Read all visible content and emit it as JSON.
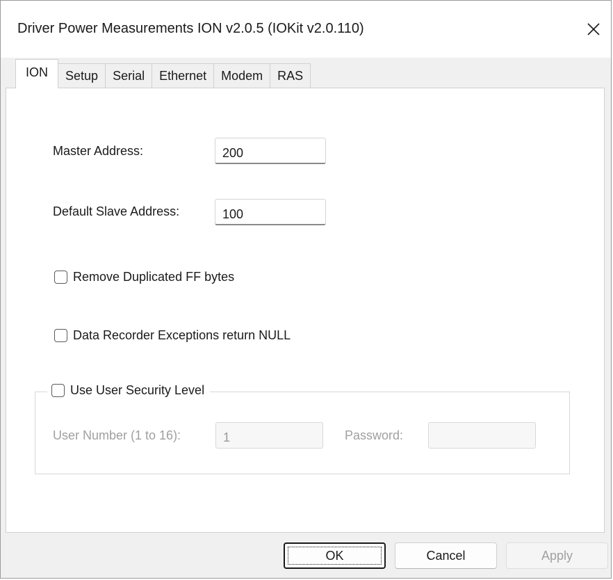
{
  "window": {
    "title": "Driver Power Measurements ION v2.0.5 (IOKit v2.0.110)",
    "close_icon": "close-icon"
  },
  "tabs": [
    {
      "label": "ION",
      "active": true
    },
    {
      "label": "Setup",
      "active": false
    },
    {
      "label": "Serial",
      "active": false
    },
    {
      "label": "Ethernet",
      "active": false
    },
    {
      "label": "Modem",
      "active": false
    },
    {
      "label": "RAS",
      "active": false
    }
  ],
  "ion": {
    "master_address": {
      "label": "Master Address:",
      "value": "200"
    },
    "default_slave_address": {
      "label": "Default Slave Address:",
      "value": "100"
    },
    "remove_duplicated_ff": {
      "label": "Remove Duplicated FF bytes",
      "checked": false
    },
    "data_recorder_null": {
      "label": "Data Recorder Exceptions return NULL",
      "checked": false
    },
    "security": {
      "label": "Use User Security Level",
      "checked": false,
      "user_number": {
        "label": "User Number (1 to 16):",
        "value": "1"
      },
      "password": {
        "label": "Password:",
        "value": ""
      }
    }
  },
  "buttons": {
    "ok": "OK",
    "cancel": "Cancel",
    "apply": "Apply"
  },
  "colors": {
    "dialog_bg": "#f0f0f0",
    "panel_bg": "#ffffff",
    "disabled_text": "#a0a0a0"
  }
}
